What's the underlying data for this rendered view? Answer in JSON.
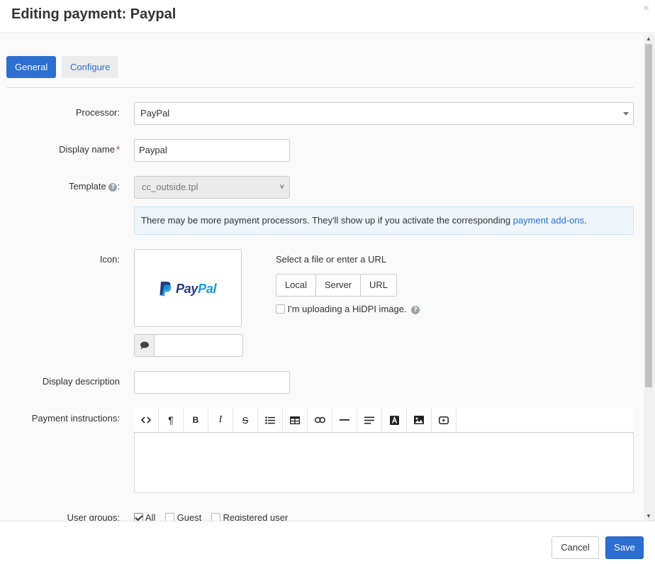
{
  "modal": {
    "title": "Editing payment: Paypal",
    "close_glyph": "×"
  },
  "tabs": [
    {
      "label": "General",
      "active": true
    },
    {
      "label": "Configure",
      "active": false
    }
  ],
  "form": {
    "processor": {
      "label": "Processor:",
      "value": "PayPal"
    },
    "display_name": {
      "label": "Display name",
      "required_mark": "*",
      "value": "Paypal"
    },
    "template": {
      "label": "Template",
      "label_suffix": ":",
      "value": "cc_outside.tpl",
      "help_icon": "question-circle-icon"
    },
    "info": {
      "text": "There may be more payment processors. They'll show up if you activate the corresponding ",
      "link": "payment add-ons",
      "after": "."
    },
    "icon": {
      "label": "Icon:",
      "logo_text_part1": "Pay",
      "logo_text_part2": "Pal",
      "alt_text_value": "",
      "file_prompt": "Select a file or enter a URL",
      "sources": [
        "Local",
        "Server",
        "URL"
      ],
      "hidpi_label": "I'm uploading a HiDPI image.",
      "hidpi_checked": false
    },
    "display_description": {
      "label": "Display description",
      "value": ""
    },
    "payment_instructions": {
      "label": "Payment instructions:",
      "toolbar_icons": [
        "code-view-icon",
        "paragraph-icon",
        "bold-icon",
        "italic-icon",
        "strikethrough-icon",
        "bulleted-list-icon",
        "table-icon",
        "link-icon",
        "horizontal-rule-icon",
        "align-icon",
        "text-color-icon",
        "image-icon",
        "video-icon"
      ]
    },
    "user_groups": {
      "label": "User groups:",
      "options": [
        {
          "label": "All",
          "checked": true
        },
        {
          "label": "Guest",
          "checked": false
        },
        {
          "label": "Registered user",
          "checked": false
        }
      ]
    }
  },
  "footer": {
    "cancel_label": "Cancel",
    "save_label": "Save"
  },
  "colors": {
    "primary": "#2d6ed1",
    "required": "#d9304a",
    "paypal_dark": "#253b80",
    "paypal_light": "#179bd7"
  }
}
